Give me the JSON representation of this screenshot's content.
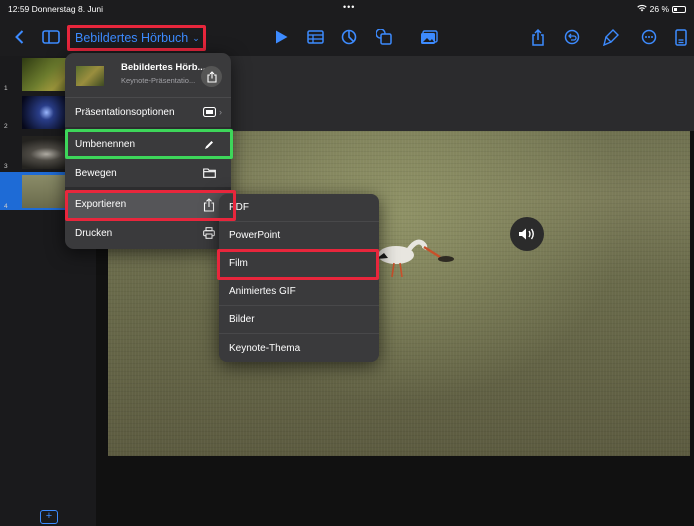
{
  "status": {
    "time": "12:59",
    "date": "Donnerstag 8. Juni",
    "battery": "26 %",
    "dots": "•••"
  },
  "toolbar": {
    "document_title": "Bebildertes Hörbuch",
    "icons": [
      "back-chevron",
      "sidebar-toggle",
      "play",
      "table",
      "chart",
      "shape",
      "media",
      "share",
      "undo",
      "format-brush",
      "more",
      "document-inspector"
    ]
  },
  "slides": [
    {
      "number": "1"
    },
    {
      "number": "2"
    },
    {
      "number": "3"
    },
    {
      "number": "4",
      "selected": true
    }
  ],
  "file_menu": {
    "title": "Bebildertes Hörb...",
    "subtitle": "Keynote-Präsentatio...",
    "items": [
      {
        "label": "Präsentationsoptionen",
        "icon": "toggle-icon",
        "submenu": true
      },
      {
        "label": "Umbenennen",
        "icon": "pencil-icon"
      },
      {
        "label": "Bewegen",
        "icon": "folder-icon"
      },
      {
        "label": "Exportieren",
        "icon": "export-icon",
        "highlighted": true
      },
      {
        "label": "Drucken",
        "icon": "printer-icon"
      }
    ]
  },
  "export_menu": {
    "items": [
      {
        "label": "PDF"
      },
      {
        "label": "PowerPoint"
      },
      {
        "label": "Film"
      },
      {
        "label": "Animiertes GIF"
      },
      {
        "label": "Bilder"
      },
      {
        "label": "Keynote-Thema"
      }
    ]
  },
  "annotation_colors": {
    "red": "#e8263c",
    "green": "#3dd65a",
    "accent": "#3d8bff"
  }
}
